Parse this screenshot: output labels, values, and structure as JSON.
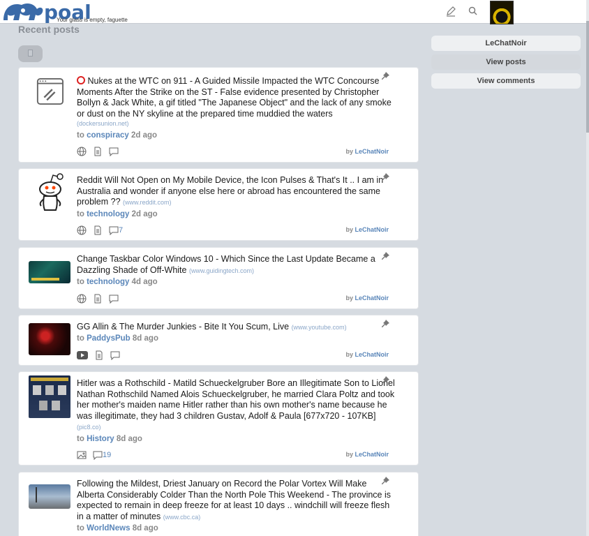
{
  "header": {
    "logo_text": "poal",
    "tagline": "Your glass is empty, faguette",
    "icons": [
      "pencil-icon",
      "search-icon"
    ]
  },
  "main": {
    "section_title": "Recent posts",
    "posts": [
      {
        "title": "Nukes at the WTC on 911 - A Guided Missile Impacted the WTC Concourse Moments After the Strike on the ST - False evidence presented by Christopher Bollyn & Jack White, a gif titled \"The Japanese Object\" and the lack of any smoke or dust on the NY skyline at the prepared time muddied the waters",
        "domain": "(dockersunion.net)",
        "to_label": "to",
        "sub": "conspiracy",
        "age": "2d ago",
        "comments": "",
        "by_label": "by",
        "user": "LeChatNoir",
        "thumb_icon": "link-icon"
      },
      {
        "title": "Reddit Will Not Open on My Mobile Device, the Icon Pulses & That's It .. I am in Australia and wonder if anyone else here or abroad has encountered the same problem ??",
        "domain": "(www.reddit.com)",
        "to_label": "to",
        "sub": "technology",
        "age": "2d ago",
        "comments": "7",
        "by_label": "by",
        "user": "LeChatNoir",
        "thumb_icon": "reddit-alien-icon"
      },
      {
        "title": "Change Taskbar Color Windows 10 - Which Since the Last Update Became a Dazzling Shade of Off-White",
        "domain": "(www.guidingtech.com)",
        "to_label": "to",
        "sub": "technology",
        "age": "4d ago",
        "comments": "",
        "by_label": "by",
        "user": "LeChatNoir",
        "thumb_icon": "windows-screenshot-thumb"
      },
      {
        "title": "GG Allin & The Murder Junkies - Bite It You Scum, Live",
        "domain": "(www.youtube.com)",
        "to_label": "to",
        "sub": "PaddysPub",
        "age": "8d ago",
        "comments": "",
        "by_label": "by",
        "user": "LeChatNoir",
        "thumb_icon": "concert-photo-thumb"
      },
      {
        "title": "Hitler was a Rothschild - Matild Schueckelgruber Bore an Illegitimate Son to Lionel Nathan Rothschild Named Alois Schueckelgruber, he married Clara Poltz and took her mother's maiden name Hitler rather than his own mother's name because he was illegitimate, they had 3 children Gustav, Adolf & Paula [677x720 - 107KB]",
        "domain": "(pic8.co)",
        "to_label": "to",
        "sub": "History",
        "age": "8d ago",
        "comments": "19",
        "by_label": "by",
        "user": "LeChatNoir",
        "thumb_icon": "infographic-thumb"
      },
      {
        "title": "Following the Mildest, Driest January on Record the Polar Vortex Will Make Alberta Considerably Colder Than the North Pole This Weekend - The province is expected to remain in deep freeze for at least 10 days .. windchill will freeze flesh in a matter of minutes",
        "domain": "(www.cbc.ca)",
        "to_label": "to",
        "sub": "WorldNews",
        "age": "8d ago",
        "comments": "",
        "by_label": "by",
        "user": "LeChatNoir",
        "thumb_icon": "frost-photo-thumb"
      }
    ]
  },
  "sidebar": {
    "username": "LeChatNoir",
    "view_posts": "View posts",
    "view_comments": "View comments"
  },
  "colors": {
    "accent": "#5a86b9",
    "background": "#d6dbe1",
    "logo": "#3a6aa8"
  }
}
